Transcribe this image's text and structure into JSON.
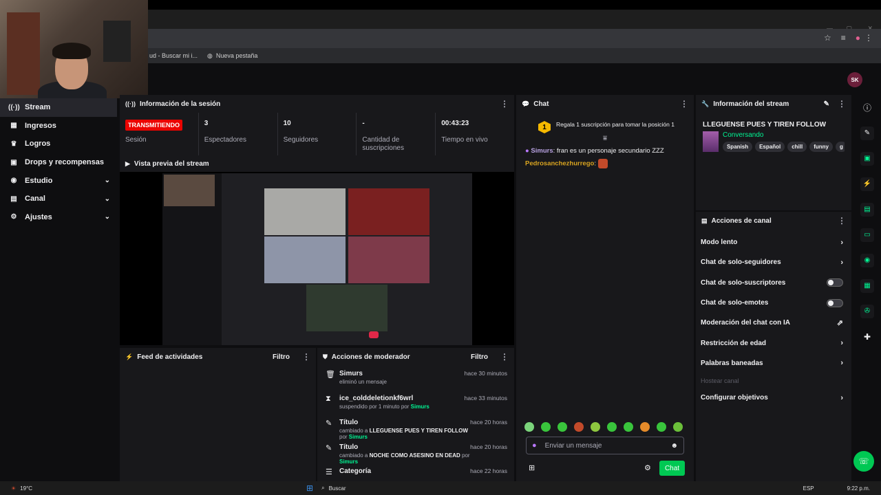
{
  "browser": {
    "bookmarks": [
      "ud - Buscar mi i...",
      "Nueva pestaña"
    ]
  },
  "header": {
    "avatar_initials": "SK"
  },
  "sidebar": {
    "items": [
      {
        "label": "Stream",
        "icon": "broadcast-icon",
        "glyph": "((·))",
        "active": true,
        "expandable": false
      },
      {
        "label": "Ingresos",
        "icon": "money-icon",
        "glyph": "▦",
        "active": false,
        "expandable": false
      },
      {
        "label": "Logros",
        "icon": "trophy-icon",
        "glyph": "♛",
        "active": false,
        "expandable": false
      },
      {
        "label": "Drops y recompensas",
        "icon": "gift-icon",
        "glyph": "▣",
        "active": false,
        "expandable": false
      },
      {
        "label": "Estudio",
        "icon": "studio-icon",
        "glyph": "◉",
        "active": false,
        "expandable": true
      },
      {
        "label": "Canal",
        "icon": "channel-icon",
        "glyph": "▤",
        "active": false,
        "expandable": true
      },
      {
        "label": "Ajustes",
        "icon": "settings-icon",
        "glyph": "⚙",
        "active": false,
        "expandable": true
      }
    ]
  },
  "session": {
    "title": "Información de la sesión",
    "stats": [
      {
        "value": "TRANSMITIENDO",
        "label": "Sesión",
        "live": true
      },
      {
        "value": "3",
        "label": "Espectadores"
      },
      {
        "value": "10",
        "label": "Seguidores"
      },
      {
        "value": "-",
        "label": "Cantidad de suscripciones"
      },
      {
        "value": "00:43:23",
        "label": "Tiempo en vivo"
      }
    ]
  },
  "preview": {
    "title": "Vista previa del stream"
  },
  "feed": {
    "title": "Feed de actividades",
    "filter": "Filtro"
  },
  "mod": {
    "title": "Acciones de moderador",
    "filter": "Filtro",
    "rows": [
      {
        "icon": "trash-icon",
        "glyph": "🗑",
        "name": "Simurs",
        "pre": "eliminó un mensaje",
        "bold": "",
        "post": "",
        "by": "",
        "time": "hace 30 minutos"
      },
      {
        "icon": "hourglass-icon",
        "glyph": "⧗",
        "name": "ice_colddeletionkf6wrl",
        "pre": "suspendido por 1 minuto por",
        "bold": "",
        "post": "",
        "by": "Simurs",
        "time": "hace 33 minutos"
      },
      {
        "icon": "user-edit-icon",
        "glyph": "✎",
        "name": "Título",
        "pre": "cambiado a",
        "bold": "LLEGUENSE PUES Y TIREN FOLLOW",
        "post": "por",
        "by": "Simurs",
        "time": "hace 20 horas"
      },
      {
        "icon": "user-edit-icon",
        "glyph": "✎",
        "name": "Título",
        "pre": "cambiado a",
        "bold": "NOCHE COMO ASESINO EN DEAD",
        "post": "por",
        "by": "Simurs",
        "time": "hace 20 horas"
      },
      {
        "icon": "category-icon",
        "glyph": "☰",
        "name": "Categoría",
        "pre": "",
        "bold": "",
        "post": "",
        "by": "",
        "time": "hace 22 horas"
      }
    ]
  },
  "chat": {
    "title": "Chat",
    "gift_text": "Regala 1 suscripción para tomar la posición 1",
    "gift_rank": "1",
    "messages": [
      {
        "user": "Simurs",
        "color": "#b9a3e3",
        "text": "fran es un personaje secundario ZZZ"
      },
      {
        "user": "Pedrosanchezhurrego",
        "color": "#daa520",
        "text": ""
      }
    ],
    "input_placeholder": "Enviar un mensaje",
    "send_label": "Chat",
    "emote_colors": [
      "#7bd47b",
      "#39c43c",
      "#39c43c",
      "#c24a2a",
      "#8ec63f",
      "#39c43c",
      "#39c43c",
      "#e48a2a",
      "#39c43c",
      "#6bbf3a"
    ]
  },
  "stream_info": {
    "header": "Información del stream",
    "title": "LLEGUENSE PUES Y TIREN FOLLOW",
    "category": "Conversando",
    "tags": [
      "Spanish",
      "Español",
      "chill",
      "funny",
      "g"
    ]
  },
  "channel_actions": {
    "header": "Acciones de canal",
    "items": [
      {
        "label": "Modo lento",
        "type": "arrow"
      },
      {
        "label": "Chat de solo-seguidores",
        "type": "arrow"
      },
      {
        "label": "Chat de solo-suscriptores",
        "type": "toggle"
      },
      {
        "label": "Chat de solo-emotes",
        "type": "toggle"
      },
      {
        "label": "Moderación del chat con IA",
        "type": "external"
      },
      {
        "label": "Restricción de edad",
        "type": "arrow"
      },
      {
        "label": "Palabras baneadas",
        "type": "arrow"
      },
      {
        "label": "Hostear canal",
        "type": "disabled"
      },
      {
        "label": "Configurar objetivos",
        "type": "arrow"
      }
    ]
  },
  "taskbar": {
    "weather": "19°C",
    "search": "Buscar",
    "lang": "ESP",
    "time": "9:22 p.m."
  },
  "colors": {
    "accent_green": "#00f593",
    "live_red": "#eb0400",
    "panel": "#18181b",
    "bg": "#0e0e10"
  }
}
